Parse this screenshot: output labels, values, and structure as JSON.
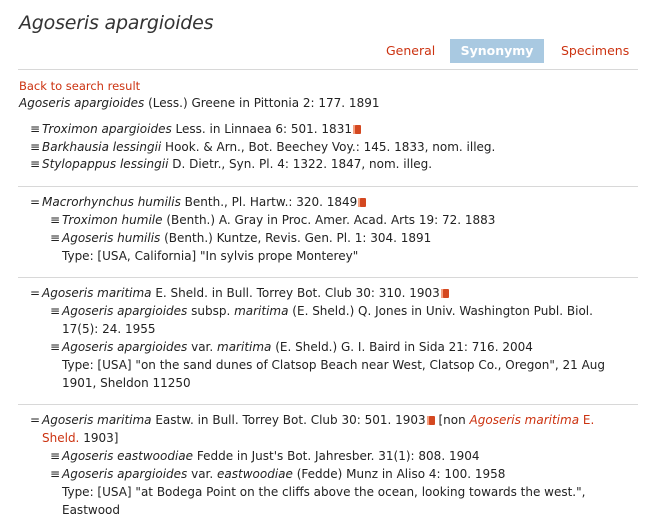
{
  "title": "Agoseris apargioides",
  "tabs": [
    "General",
    "Synonymy",
    "Specimens"
  ],
  "back": "Back to search result",
  "accepted": {
    "name": "Agoseris apargioides",
    "rest": " (Less.) Greene in Pittonia 2: 177. 1891"
  },
  "g1": {
    "a": {
      "sym": "≡",
      "name": "Troximon apargioides",
      "rest": " Less. in Linnaea 6: 501. 1831"
    },
    "b": {
      "sym": "≡",
      "name": "Barkhausia lessingii",
      "rest": " Hook. & Arn., Bot. Beechey Voy.: 145. 1833, nom. illeg."
    },
    "c": {
      "sym": "≡",
      "name": "Stylopappus lessingii",
      "rest": " D. Dietr., Syn. Pl. 4: 1322. 1847, nom. illeg."
    }
  },
  "g2": {
    "a": {
      "sym": "=",
      "name": "Macrorhynchus humilis",
      "rest": " Benth., Pl. Hartw.: 320. 1849"
    },
    "b": {
      "sym": "≡",
      "name": "Troximon humile",
      "rest": " (Benth.) A. Gray in Proc. Amer. Acad. Arts 19: 72. 1883"
    },
    "c": {
      "sym": "≡",
      "name": "Agoseris humilis",
      "rest": " (Benth.) Kuntze, Revis. Gen. Pl. 1: 304. 1891"
    },
    "type": "Type: [USA, California] \"In sylvis prope Monterey\""
  },
  "g3": {
    "a": {
      "sym": "=",
      "name": "Agoseris maritima",
      "rest": " E. Sheld. in Bull. Torrey Bot. Club 30: 310. 1903"
    },
    "b": {
      "sym": "≡",
      "name": "Agoseris apargioides",
      "mid": " subsp. ",
      "name2": "maritima",
      "rest": " (E. Sheld.) Q. Jones in Univ. Washington Publ. Biol.",
      "rest2": "17(5): 24. 1955"
    },
    "c": {
      "sym": "≡",
      "name": "Agoseris apargioides",
      "mid": " var. ",
      "name2": "maritima",
      "rest": " (E. Sheld.) G. I. Baird in Sida 21: 716. 2004"
    },
    "type1": "Type: [USA] \"on the sand dunes of Clatsop Beach near West, Clatsop Co., Oregon\", 21 Aug",
    "type2": "1901, Sheldon 11250"
  },
  "g4": {
    "a": {
      "sym": "=",
      "name": "Agoseris maritima",
      "rest": " Eastw. in Bull. Torrey Bot. Club 30: 501. 1903",
      "non_pre": " [non ",
      "non_name": "Agoseris maritima",
      "non_auth": " E.",
      "non_auth2": "Sheld.",
      "non_post": " 1903]"
    },
    "b": {
      "sym": "≡",
      "name": "Agoseris eastwoodiae",
      "rest": " Fedde in Just's Bot. Jahresber. 31(1): 808. 1904"
    },
    "c": {
      "sym": "≡",
      "name": "Agoseris apargioides",
      "mid": " var. ",
      "name2": "eastwoodiae",
      "rest": " (Fedde) Munz in Aliso 4: 100. 1958"
    },
    "type1": "Type: [USA] \"at Bodega Point on the cliffs above the ocean, looking towards the west.\",",
    "type2": "Eastwood"
  },
  "colors": {
    "link": "#cc3311",
    "tab_active": "#a9c9e1"
  },
  "icons": [
    "book-icon"
  ]
}
